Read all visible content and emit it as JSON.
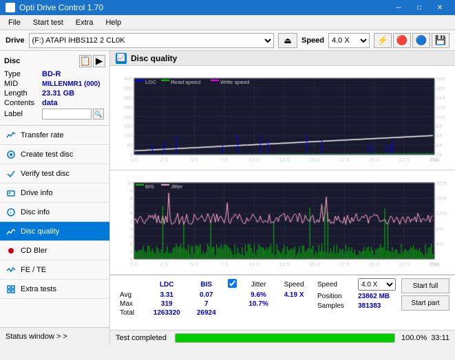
{
  "titleBar": {
    "title": "Opti Drive Control 1.70",
    "minimizeLabel": "─",
    "maximizeLabel": "□",
    "closeLabel": "✕"
  },
  "menuBar": {
    "items": [
      "File",
      "Start test",
      "Extra",
      "Help"
    ]
  },
  "driveBar": {
    "label": "Drive",
    "driveValue": "(F:)  ATAPI iHBS112  2 CL0K",
    "speedLabel": "Speed",
    "speedValue": "4.0 X"
  },
  "disc": {
    "title": "Disc",
    "typeLabel": "Type",
    "typeValue": "BD-R",
    "midLabel": "MID",
    "midValue": "MILLENMR1 (000)",
    "lengthLabel": "Length",
    "lengthValue": "23.31 GB",
    "contentsLabel": "Contents",
    "contentsValue": "data",
    "labelLabel": "Label",
    "labelValue": ""
  },
  "navItems": [
    {
      "id": "transfer-rate",
      "label": "Transfer rate",
      "icon": "📊"
    },
    {
      "id": "create-test-disc",
      "label": "Create test disc",
      "icon": "💿"
    },
    {
      "id": "verify-test-disc",
      "label": "Verify test disc",
      "icon": "✔"
    },
    {
      "id": "drive-info",
      "label": "Drive info",
      "icon": "ℹ"
    },
    {
      "id": "disc-info",
      "label": "Disc info",
      "icon": "📋"
    },
    {
      "id": "disc-quality",
      "label": "Disc quality",
      "icon": "📈",
      "active": true
    },
    {
      "id": "cd-bler",
      "label": "CD Bler",
      "icon": "🔴"
    },
    {
      "id": "fe-te",
      "label": "FE / TE",
      "icon": "📉"
    },
    {
      "id": "extra-tests",
      "label": "Extra tests",
      "icon": "🔧"
    }
  ],
  "statusWindow": {
    "label": "Status window > >"
  },
  "discQuality": {
    "title": "Disc quality"
  },
  "charts": {
    "topChart": {
      "title": "LDC",
      "legends": [
        {
          "label": "LDC",
          "color": "#0000ff"
        },
        {
          "label": "Read speed",
          "color": "#00cc00"
        },
        {
          "label": "Write speed",
          "color": "#ff00ff"
        }
      ],
      "yMax": 400,
      "yLabels": [
        400,
        350,
        300,
        250,
        200,
        150,
        100,
        50
      ],
      "yRightLabels": [
        "18X",
        "16X",
        "14X",
        "12X",
        "10X",
        "8X",
        "6X",
        "4X",
        "2X"
      ],
      "xLabels": [
        "0.0",
        "2.5",
        "5.0",
        "7.5",
        "10.0",
        "12.5",
        "15.0",
        "17.5",
        "20.0",
        "22.5",
        "25.0"
      ],
      "xUnit": "GB"
    },
    "bottomChart": {
      "title": "BIS",
      "legends": [
        {
          "label": "BIS",
          "color": "#00cc00"
        },
        {
          "label": "Jitter",
          "color": "#ff99cc"
        }
      ],
      "yMax": 10,
      "yLabels": [
        10,
        9,
        8,
        7,
        6,
        5,
        4,
        3,
        2,
        1
      ],
      "yRightLabels": [
        "20%",
        "16%",
        "12%",
        "8%",
        "4%"
      ],
      "xLabels": [
        "0.0",
        "2.5",
        "5.0",
        "7.5",
        "10.0",
        "12.5",
        "15.0",
        "17.5",
        "20.0",
        "22.5",
        "25.0"
      ],
      "xUnit": "GB"
    }
  },
  "stats": {
    "headers": [
      "",
      "LDC",
      "BIS",
      "",
      "Jitter",
      "Speed"
    ],
    "avg": {
      "label": "Avg",
      "ldc": "3.31",
      "bis": "0.07",
      "jitter": "9.6%",
      "speed": "4.19 X"
    },
    "max": {
      "label": "Max",
      "ldc": "319",
      "bis": "7",
      "jitter": "10.7%",
      "position": "23862 MB"
    },
    "total": {
      "label": "Total",
      "ldc": "1263320",
      "bis": "26924",
      "samples": "381383"
    },
    "jitterChecked": true,
    "speedValue": "4.0 X",
    "positionLabel": "Position",
    "samplesLabel": "Samples"
  },
  "buttons": {
    "startFull": "Start full",
    "startPart": "Start part"
  },
  "progressBar": {
    "statusText": "Test completed",
    "percentage": "100.0%",
    "fillPercent": 100,
    "time": "33:11"
  }
}
